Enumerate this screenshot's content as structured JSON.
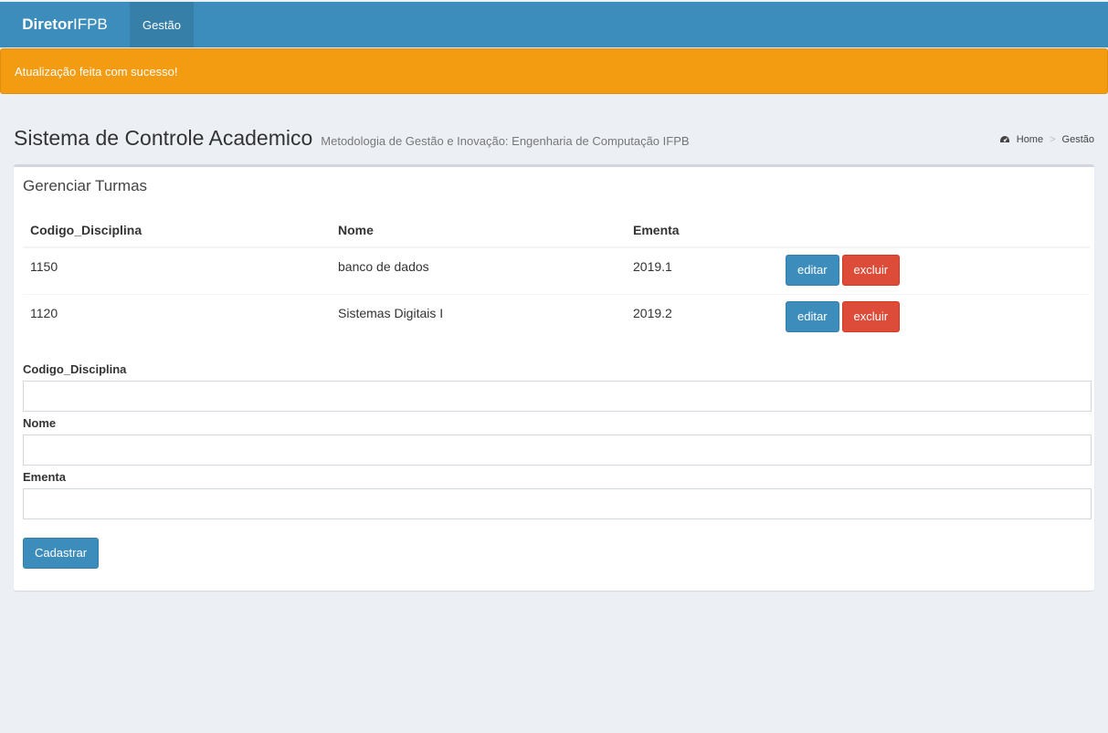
{
  "navbar": {
    "brand_bold": "Diretor",
    "brand_light": "IFPB",
    "menu_item": "Gestão"
  },
  "alert": {
    "message": "Atualização feita com sucesso!",
    "color": "#f39c12"
  },
  "header": {
    "title": "Sistema de Controle Academico",
    "subtitle": "Metodologia de Gestão e Inovação: Engenharia de Computação IFPB",
    "breadcrumb": {
      "home_icon": "dashboard-icon",
      "home": "Home",
      "current": "Gestão"
    }
  },
  "box": {
    "title": "Gerenciar Turmas",
    "table": {
      "columns": [
        "Codigo_Disciplina",
        "Nome",
        "Ementa"
      ],
      "rows": [
        {
          "codigo": "1150",
          "nome": "banco de dados",
          "ementa": "2019.1",
          "edit": "editar",
          "delete": "excluir"
        },
        {
          "codigo": "1120",
          "nome": "Sistemas Digitais I",
          "ementa": "2019.2",
          "edit": "editar",
          "delete": "excluir"
        }
      ]
    },
    "form": {
      "codigo_label": "Codigo_Disciplina",
      "codigo_value": "",
      "nome_label": "Nome",
      "nome_value": "",
      "ementa_label": "Ementa",
      "ementa_value": "",
      "submit": "Cadastrar"
    }
  },
  "colors": {
    "primary": "#3c8dbc",
    "danger": "#dd4b39",
    "warning": "#f39c12",
    "background": "#ecf0f5"
  }
}
